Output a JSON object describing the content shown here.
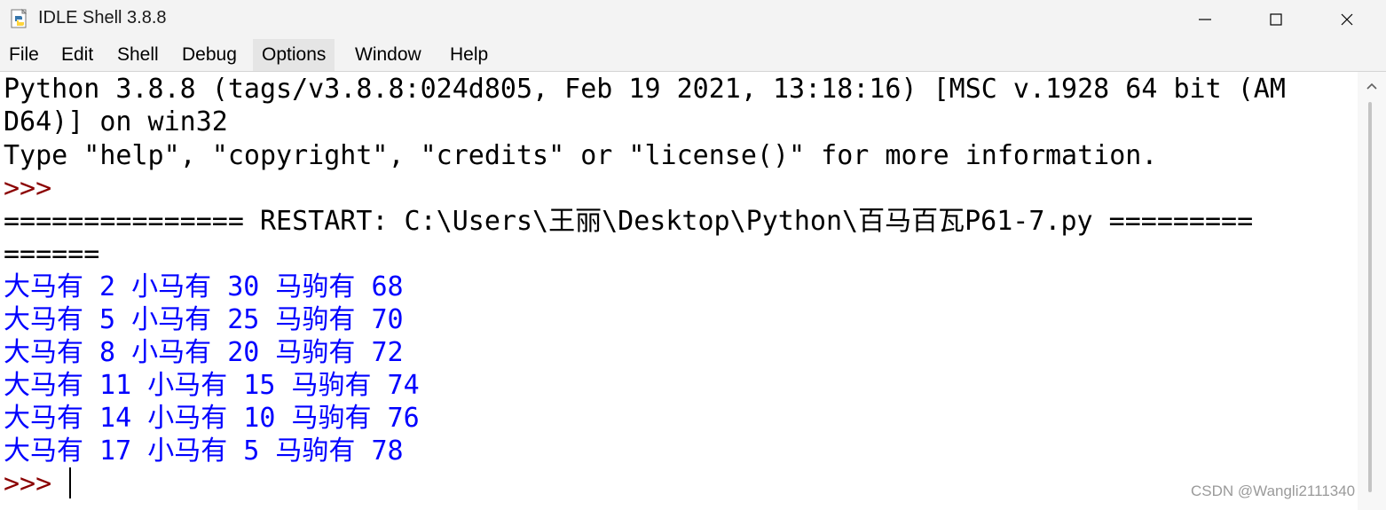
{
  "window": {
    "title": "IDLE Shell 3.8.8"
  },
  "menu": {
    "items": [
      {
        "label": "File"
      },
      {
        "label": "Edit"
      },
      {
        "label": "Shell"
      },
      {
        "label": "Debug"
      },
      {
        "label": "Options"
      },
      {
        "label": "Window"
      },
      {
        "label": "Help"
      }
    ],
    "active": "Options"
  },
  "shell": {
    "lines": [
      "Python 3.8.8 (tags/v3.8.8:024d805, Feb 19 2021, 13:18:16) [MSC v.1928 64 bit (AM",
      "D64)] on win32",
      "Type \"help\", \"copyright\", \"credits\" or \"license()\" for more information.",
      ">>>",
      "=============== RESTART: C:\\Users\\王丽\\Desktop\\Python\\百马百瓦P61-7.py =========",
      "======"
    ],
    "output": [
      "大马有 2 小马有 30 马驹有 68",
      "大马有 5 小马有 25 马驹有 70",
      "大马有 8 小马有 20 马驹有 72",
      "大马有 11 小马有 15 马驹有 74",
      "大马有 14 小马有 10 马驹有 76",
      "大马有 17 小马有 5 马驹有 78"
    ],
    "prompt": ">>>"
  },
  "colors": {
    "output_text": "#0000ff",
    "prompt": "#8b0000",
    "chrome": "#f3f3f3"
  },
  "watermark": "CSDN @Wangli2111340"
}
